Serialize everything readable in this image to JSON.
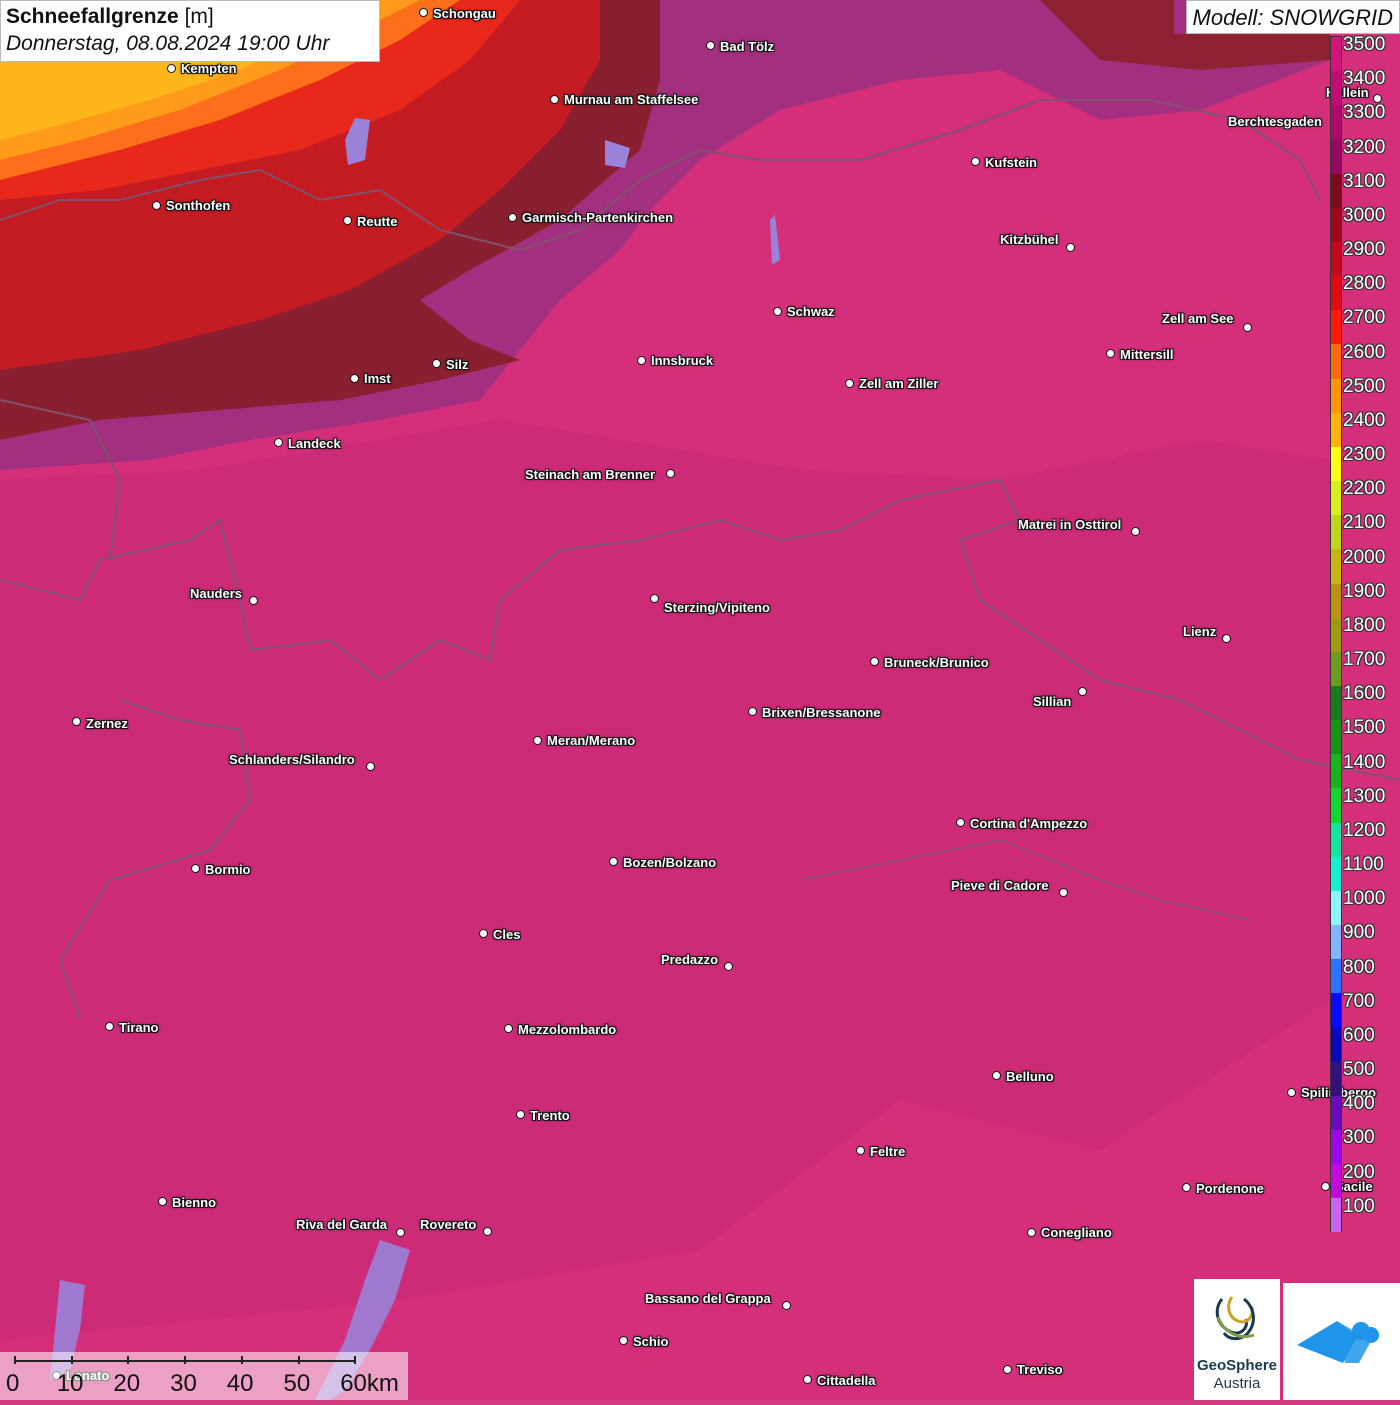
{
  "title": {
    "variable": "Schneefallgrenze",
    "unit": "[m]",
    "datetime": "Donnerstag, 08.08.2024 19:00 Uhr"
  },
  "model_label": "Modell: SNOWGRID",
  "legend": {
    "labels": [
      "3500",
      "3400",
      "3300",
      "3200",
      "3100",
      "3000",
      "2900",
      "2800",
      "2700",
      "2600",
      "2500",
      "2400",
      "2300",
      "2200",
      "2100",
      "2000",
      "1900",
      "1800",
      "1700",
      "1600",
      "1500",
      "1400",
      "1300",
      "1200",
      "1100",
      "1000",
      "900",
      "800",
      "700",
      "600",
      "500",
      "400",
      "300",
      "200",
      "100"
    ],
    "colors": [
      "#d4147a",
      "#c20d74",
      "#ad0a6e",
      "#960860",
      "#7a0a1c",
      "#a0061a",
      "#c4081e",
      "#e00c14",
      "#ff1a0a",
      "#ff6a0a",
      "#ff930a",
      "#ffb30a",
      "#ffff14",
      "#d8ef1e",
      "#bcd620",
      "#c8b414",
      "#bc9210",
      "#a09a10",
      "#6c9c1c",
      "#1c7c1c",
      "#149614",
      "#18b418",
      "#14d630",
      "#14e6a0",
      "#14f0cc",
      "#8cf4ff",
      "#84b4ff",
      "#2c74ff",
      "#0a0aff",
      "#0a0ab4",
      "#34107c",
      "#6a0cbc",
      "#9a0ae6",
      "#c30adc",
      "#c864ee"
    ]
  },
  "cities": [
    {
      "name": "Schongau",
      "dot": [
        424,
        13
      ],
      "lab": [
        433,
        7
      ]
    },
    {
      "name": "Bad Tölz",
      "dot": [
        711,
        46
      ],
      "lab": [
        720,
        40
      ]
    },
    {
      "name": "Kempten",
      "dot": [
        172,
        69
      ],
      "lab": [
        181,
        62
      ]
    },
    {
      "name": "Murnau am Staffelsee",
      "dot": [
        555,
        100
      ],
      "lab": [
        564,
        93
      ]
    },
    {
      "name": "Berchtesgaden",
      "dot": null,
      "lab": [
        1228,
        115
      ]
    },
    {
      "name": "Hallein",
      "dot": [
        1378,
        99
      ],
      "lab": [
        1326,
        86
      ]
    },
    {
      "name": "Kufstein",
      "dot": [
        976,
        162
      ],
      "lab": [
        985,
        156
      ]
    },
    {
      "name": "Sonthofen",
      "dot": [
        157,
        206
      ],
      "lab": [
        166,
        199
      ]
    },
    {
      "name": "Reutte",
      "dot": [
        348,
        221
      ],
      "lab": [
        357,
        215
      ]
    },
    {
      "name": "Garmisch-Partenkirchen",
      "dot": [
        513,
        218
      ],
      "lab": [
        522,
        211
      ]
    },
    {
      "name": "Kitzbühel",
      "dot": [
        1071,
        248
      ],
      "lab": [
        1000,
        233
      ]
    },
    {
      "name": "Schwaz",
      "dot": [
        778,
        312
      ],
      "lab": [
        787,
        305
      ]
    },
    {
      "name": "Zell am See",
      "dot": [
        1248,
        328
      ],
      "lab": [
        1162,
        312
      ]
    },
    {
      "name": "Innsbruck",
      "dot": [
        642,
        361
      ],
      "lab": [
        651,
        354
      ]
    },
    {
      "name": "Mittersill",
      "dot": [
        1111,
        354
      ],
      "lab": [
        1120,
        348
      ]
    },
    {
      "name": "Silz",
      "dot": [
        437,
        364
      ],
      "lab": [
        446,
        358
      ]
    },
    {
      "name": "Imst",
      "dot": [
        355,
        379
      ],
      "lab": [
        364,
        372
      ]
    },
    {
      "name": "Zell am Ziller",
      "dot": [
        850,
        384
      ],
      "lab": [
        859,
        377
      ]
    },
    {
      "name": "Landeck",
      "dot": [
        279,
        443
      ],
      "lab": [
        288,
        437
      ]
    },
    {
      "name": "Steinach am Brenner",
      "dot": [
        671,
        474
      ],
      "lab": [
        525,
        468
      ]
    },
    {
      "name": "Matrei in Osttirol",
      "dot": [
        1136,
        532
      ],
      "lab": [
        1018,
        518
      ]
    },
    {
      "name": "Nauders",
      "dot": [
        254,
        601
      ],
      "lab": [
        190,
        587
      ]
    },
    {
      "name": "Sterzing/Vipiteno",
      "dot": [
        655,
        599
      ],
      "lab": [
        664,
        601
      ]
    },
    {
      "name": "Lienz",
      "dot": [
        1227,
        639
      ],
      "lab": [
        1183,
        625
      ]
    },
    {
      "name": "Bruneck/Brunico",
      "dot": [
        875,
        662
      ],
      "lab": [
        884,
        656
      ]
    },
    {
      "name": "Sillian",
      "dot": [
        1083,
        692
      ],
      "lab": [
        1033,
        695
      ]
    },
    {
      "name": "Brixen/Bressanone",
      "dot": [
        753,
        712
      ],
      "lab": [
        762,
        706
      ]
    },
    {
      "name": "Zernez",
      "dot": [
        77,
        722
      ],
      "lab": [
        86,
        717
      ]
    },
    {
      "name": "Meran/Merano",
      "dot": [
        538,
        741
      ],
      "lab": [
        547,
        734
      ]
    },
    {
      "name": "Schlanders/Silandro",
      "dot": [
        371,
        767
      ],
      "lab": [
        229,
        753
      ]
    },
    {
      "name": "Cortina d'Ampezzo",
      "dot": [
        961,
        823
      ],
      "lab": [
        970,
        817
      ]
    },
    {
      "name": "Bozen/Bolzano",
      "dot": [
        614,
        862
      ],
      "lab": [
        623,
        856
      ]
    },
    {
      "name": "Bormio",
      "dot": [
        196,
        869
      ],
      "lab": [
        205,
        863
      ]
    },
    {
      "name": "Pieve di Cadore",
      "dot": [
        1064,
        893
      ],
      "lab": [
        951,
        879
      ]
    },
    {
      "name": "Cles",
      "dot": [
        484,
        934
      ],
      "lab": [
        493,
        928
      ]
    },
    {
      "name": "Predazzo",
      "dot": [
        729,
        967
      ],
      "lab": [
        661,
        953
      ]
    },
    {
      "name": "Tirano",
      "dot": [
        110,
        1027
      ],
      "lab": [
        119,
        1021
      ]
    },
    {
      "name": "Mezzolombardo",
      "dot": [
        509,
        1029
      ],
      "lab": [
        518,
        1023
      ]
    },
    {
      "name": "Belluno",
      "dot": [
        997,
        1076
      ],
      "lab": [
        1006,
        1070
      ]
    },
    {
      "name": "Spilimbergo",
      "dot": [
        1292,
        1093
      ],
      "lab": [
        1301,
        1086
      ]
    },
    {
      "name": "Trento",
      "dot": [
        521,
        1115
      ],
      "lab": [
        530,
        1109
      ]
    },
    {
      "name": "Feltre",
      "dot": [
        861,
        1151
      ],
      "lab": [
        870,
        1145
      ]
    },
    {
      "name": "Pordenone",
      "dot": [
        1187,
        1188
      ],
      "lab": [
        1196,
        1182
      ]
    },
    {
      "name": "Sacile",
      "dot": [
        1326,
        1187
      ],
      "lab": [
        1335,
        1180
      ]
    },
    {
      "name": "Bienno",
      "dot": [
        163,
        1202
      ],
      "lab": [
        172,
        1196
      ]
    },
    {
      "name": "Riva del Garda",
      "dot": [
        401,
        1233
      ],
      "lab": [
        296,
        1218
      ]
    },
    {
      "name": "Rovereto",
      "dot": [
        488,
        1232
      ],
      "lab": [
        420,
        1218
      ]
    },
    {
      "name": "Conegliano",
      "dot": [
        1032,
        1233
      ],
      "lab": [
        1041,
        1226
      ]
    },
    {
      "name": "Bassano del Grappa",
      "dot": [
        787,
        1306
      ],
      "lab": [
        645,
        1292
      ]
    },
    {
      "name": "Schio",
      "dot": [
        624,
        1341
      ],
      "lab": [
        633,
        1335
      ]
    },
    {
      "name": "Treviso",
      "dot": [
        1008,
        1370
      ],
      "lab": [
        1017,
        1363
      ]
    },
    {
      "name": "Cittadella",
      "dot": [
        808,
        1380
      ],
      "lab": [
        817,
        1374
      ]
    },
    {
      "name": "Lonato",
      "dot": [
        57,
        1376
      ],
      "lab": [
        66,
        1369
      ]
    }
  ],
  "scale": {
    "labels": [
      "0",
      "10",
      "20",
      "30",
      "40",
      "50",
      "60km"
    ]
  },
  "logos": {
    "geosphere_line1": "GeoSphere",
    "geosphere_line2": "Austria"
  }
}
